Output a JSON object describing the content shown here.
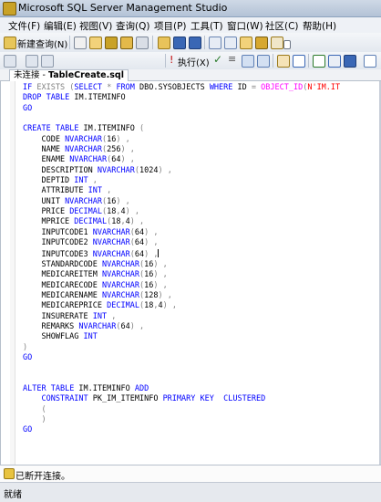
{
  "window": {
    "title": "Microsoft SQL Server Management Studio"
  },
  "menu": [
    "文件(F)",
    "编辑(E)",
    "视图(V)",
    "查询(Q)",
    "项目(P)",
    "工具(T)",
    "窗口(W)",
    "社区(C)",
    "帮助(H)"
  ],
  "toolbar": {
    "new_query_label": "新建查询(N)",
    "execute_label": "执行(X)",
    "database_combo_value": ""
  },
  "tab": {
    "prefix": "未连接 - ",
    "name": "TableCreate.sql"
  },
  "code_lines": [
    "IF EXISTS (SELECT * FROM DBO.SYSOBJECTS WHERE ID = OBJECT_ID(N'IM.IT",
    "DROP TABLE IM.ITEMINFO",
    "GO",
    "",
    "CREATE TABLE IM.ITEMINFO (",
    "    CODE NVARCHAR(16) ,",
    "    NAME NVARCHAR(256) ,",
    "    ENAME NVARCHAR(64) ,",
    "    DESCRIPTION NVARCHAR(1024) ,",
    "    DEPTID INT ,",
    "    ATTRIBUTE INT ,",
    "    UNIT NVARCHAR(16) ,",
    "    PRICE DECIMAL(18,4) ,",
    "    MPRICE DECIMAL(18,4) ,",
    "    INPUTCODE1 NVARCHAR(64) ,",
    "    INPUTCODE2 NVARCHAR(64) ,",
    "    INPUTCODE3 NVARCHAR(64) ,",
    "    STANDARDCODE NVARCHAR(16) ,",
    "    MEDICAREITEM NVARCHAR(16) ,",
    "    MEDICARECODE NVARCHAR(16) ,",
    "    MEDICARENAME NVARCHAR(128) ,",
    "    MEDICAREPRICE DECIMAL(18,4) ,",
    "    INSURERATE INT ,",
    "    REMARKS NVARCHAR(64) ,",
    "    SHOWFLAG INT",
    ")",
    "GO",
    "",
    "",
    "ALTER TABLE IM.ITEMINFO ADD",
    "    CONSTRAINT PK_IM_ITEMINFO PRIMARY KEY  CLUSTERED",
    "    (",
    "    )",
    "GO"
  ],
  "status": {
    "message": "已断开连接。",
    "ready": "就绪"
  },
  "colors": {
    "keyword": "#0000ff",
    "operator": "#808080",
    "function": "#ff00ff",
    "string": "#ff0000"
  },
  "icons": [
    "app-icon",
    "new-query-icon",
    "execute-icon",
    "parse-check-icon",
    "stop-icon",
    "disconnected-icon"
  ]
}
